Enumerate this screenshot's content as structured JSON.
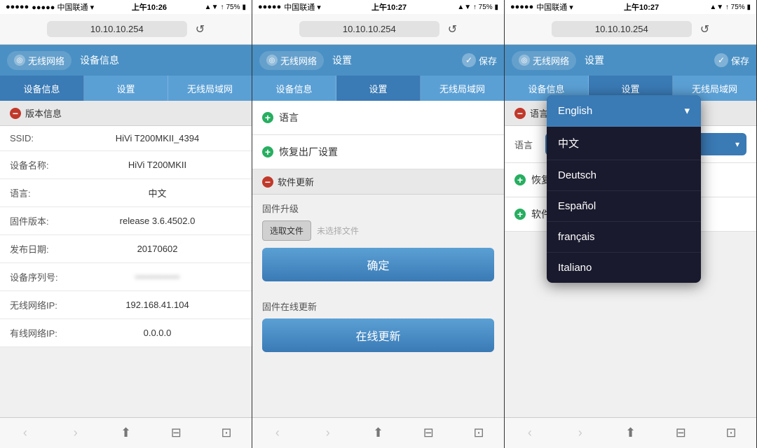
{
  "carrier": "中国联通",
  "wifi_icon": "▾",
  "panels": [
    {
      "id": "panel1",
      "status": {
        "left": "●●●●● 中国联通  ▾",
        "time": "上午10:26",
        "right": "▲▼  ↑  75%  ▮"
      },
      "address": "10.10.10.254",
      "nav": {
        "wireless_label": "无线网络",
        "settings_label": "设备信息"
      },
      "tabs": [
        {
          "label": "设备信息",
          "active": true
        },
        {
          "label": "设置",
          "active": false
        },
        {
          "label": "无线局域网",
          "active": false
        }
      ],
      "sections": [
        {
          "type": "section_header",
          "icon": "minus",
          "label": "版本信息"
        },
        {
          "type": "info_rows",
          "rows": [
            {
              "label": "SSID:",
              "value": "HiVi T200MKII_4394"
            },
            {
              "label": "设备名称:",
              "value": "HiVi T200MKII"
            },
            {
              "label": "语言:",
              "value": "中文"
            },
            {
              "label": "固件版本:",
              "value": "release 3.6.4502.0"
            },
            {
              "label": "发布日期:",
              "value": "20170602"
            },
            {
              "label": "设备序列号:",
              "value": "••••••••••••••••••",
              "blurred": true
            },
            {
              "label": "无线网络IP:",
              "value": "192.168.41.104"
            },
            {
              "label": "有线网络IP:",
              "value": "0.0.0.0"
            }
          ]
        }
      ]
    },
    {
      "id": "panel2",
      "status": {
        "left": "●●●●● 中国联通  ▾",
        "time": "上午10:27",
        "right": "▲▼  ↑  75%  ▮"
      },
      "address": "10.10.10.254",
      "nav": {
        "wireless_label": "无线网络",
        "settings_label": "设置",
        "save_label": "保存"
      },
      "tabs": [
        {
          "label": "设备信息",
          "active": false
        },
        {
          "label": "设置",
          "active": true
        },
        {
          "label": "无线局域网",
          "active": false
        }
      ],
      "menu_items": [
        {
          "icon": "plus",
          "label": "语言"
        },
        {
          "icon": "plus",
          "label": "恢复出厂设置"
        }
      ],
      "firmware": {
        "section_icon": "minus",
        "section_label": "软件更新",
        "upgrade_title": "固件升级",
        "choose_btn": "选取文件",
        "no_file": "未选择文件",
        "confirm_btn": "确定",
        "online_title": "固件在线更新",
        "online_btn": "在线更新"
      }
    },
    {
      "id": "panel3",
      "status": {
        "left": "●●●●● 中国联通  ▾",
        "time": "上午10:27",
        "right": "▲▼  ↑  75%  ▮"
      },
      "address": "10.10.10.254",
      "nav": {
        "wireless_label": "无线网络",
        "settings_label": "设置",
        "save_label": "保存"
      },
      "tabs": [
        {
          "label": "设备信息",
          "active": false
        },
        {
          "label": "设置",
          "active": true
        },
        {
          "label": "无线局域网",
          "active": false
        }
      ],
      "lang_section": {
        "icon": "minus",
        "label": "语言"
      },
      "lang_row_label": "语言",
      "lang_selected": "English",
      "menu_items_after": [
        {
          "icon": "plus",
          "label": "恢复出厂设置"
        },
        {
          "icon": "plus",
          "label": "软件更新"
        }
      ],
      "dropdown": {
        "items": [
          {
            "label": "English",
            "selected": true
          },
          {
            "label": "中文",
            "selected": false
          },
          {
            "label": "Deutsch",
            "selected": false
          },
          {
            "label": "Español",
            "selected": false
          },
          {
            "label": "français",
            "selected": false
          },
          {
            "label": "Italiano",
            "selected": false
          }
        ]
      }
    }
  ],
  "bottom_bar": {
    "back": "‹",
    "forward": "›",
    "share": "⬆",
    "bookmarks": "⊟",
    "tabs_btn": "⊡"
  }
}
